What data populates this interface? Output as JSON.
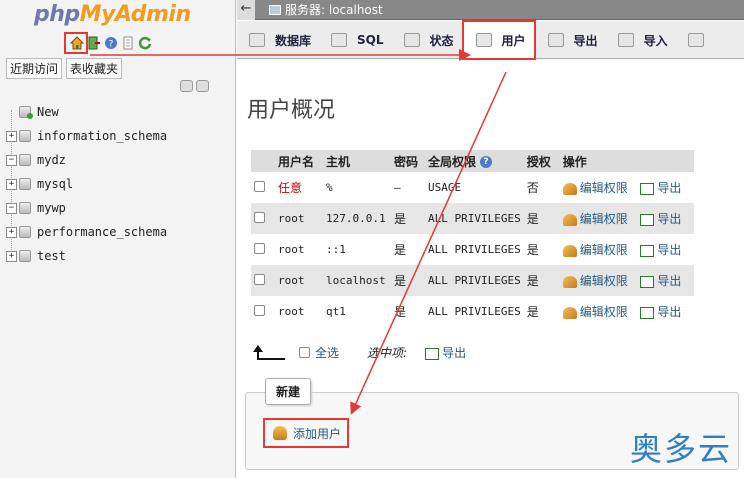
{
  "nav": {
    "logo_php": "php",
    "logo_admin": "MyAdmin",
    "icons": [
      "home-icon",
      "exit-icon",
      "help-icon",
      "docs-icon",
      "reload-icon"
    ],
    "tabs": [
      "近期访问",
      "表收藏夹"
    ],
    "tree": [
      {
        "name": "New",
        "expander": ""
      },
      {
        "name": "information_schema",
        "expander": "+"
      },
      {
        "name": "mydz",
        "expander": "−"
      },
      {
        "name": "mysql",
        "expander": "+"
      },
      {
        "name": "mywp",
        "expander": "−"
      },
      {
        "name": "performance_schema",
        "expander": "+"
      },
      {
        "name": "test",
        "expander": "+"
      }
    ]
  },
  "topbar": {
    "back": "←",
    "server": "服务器: localhost"
  },
  "menu": [
    {
      "label": "数据库",
      "icon": "database-icon"
    },
    {
      "label": "SQL",
      "icon": "sql-icon"
    },
    {
      "label": "状态",
      "icon": "status-icon"
    },
    {
      "label": "用户",
      "icon": "users-icon",
      "active": true
    },
    {
      "label": "导出",
      "icon": "export-icon"
    },
    {
      "label": "导入",
      "icon": "import-icon"
    },
    {
      "label": "",
      "icon": "wrench-icon"
    }
  ],
  "page_title": "用户概况",
  "table": {
    "headers": [
      "",
      "用户名",
      "主机",
      "密码",
      "全局权限",
      "授权",
      "操作"
    ],
    "rows": [
      {
        "user": "任意",
        "host": "%",
        "password": "—",
        "privileges": "USAGE",
        "grant": "否"
      },
      {
        "user": "root",
        "host": "127.0.0.1",
        "password": "是",
        "privileges": "ALL PRIVILEGES",
        "grant": "是"
      },
      {
        "user": "root",
        "host": "::1",
        "password": "是",
        "privileges": "ALL PRIVILEGES",
        "grant": "是"
      },
      {
        "user": "root",
        "host": "localhost",
        "password": "是",
        "privileges": "ALL PRIVILEGES",
        "grant": "是"
      },
      {
        "user": "root",
        "host": "qt1",
        "password": "是",
        "privileges": "ALL PRIVILEGES",
        "grant": "是"
      }
    ],
    "edit_label": "编辑权限",
    "export_label": "导出"
  },
  "bulk": {
    "select_all": "全选",
    "with_selected": "选中项:",
    "export": "导出"
  },
  "new_section": {
    "legend": "新建",
    "add_user": "添加用户"
  },
  "watermark": "奥多云",
  "colors": {
    "annotation": "#e53935",
    "link": "#235a81",
    "any_user": "#cc0000"
  }
}
